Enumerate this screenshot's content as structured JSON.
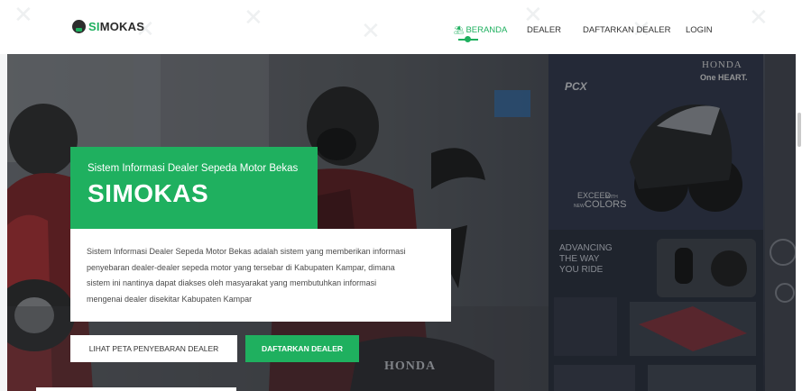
{
  "brand": {
    "si": "SI",
    "rest": "MOKAS"
  },
  "nav": {
    "items": [
      {
        "label": "BERANDA",
        "active": true,
        "icon": "home-icon"
      },
      {
        "label": "DEALER",
        "active": false
      },
      {
        "label": "DAFTARKAN DEALER",
        "active": false
      },
      {
        "label": "LOGIN",
        "active": false
      }
    ]
  },
  "hero": {
    "subtitle": "Sistem Informasi Dealer Sepeda Motor Bekas",
    "title": "SIMOKAS",
    "description_lines": [
      "Sistem Informasi Dealer Sepeda Motor Bekas adalah sistem yang memberikan informasi",
      "penyebaran dealer-dealer sepeda motor yang tersebar di Kabupaten Kampar, dimana",
      "sistem ini nantinya dapat diakses oleh masyarakat yang membutuhkan informasi",
      "mengenai dealer disekitar Kabupaten Kampar"
    ],
    "buttons": {
      "map": "LIHAT PETA PENYEBARAN DEALER",
      "register": "DAFTARKAN DEALER"
    }
  },
  "background_signage": {
    "brand_top": "HONDA",
    "tagline": "One HEART.",
    "model": "PCX",
    "exceed_a": "EXCEED",
    "exceed_b": "WITH",
    "exceed_c": "NEW",
    "colors": "COLORS",
    "adv_1": "ADVANCING",
    "adv_2": "THE WAY",
    "adv_3": "YOU RIDE",
    "plate": "HONDA"
  },
  "colors": {
    "accent": "#1fb05f",
    "text_dark": "#333333",
    "white": "#ffffff"
  }
}
